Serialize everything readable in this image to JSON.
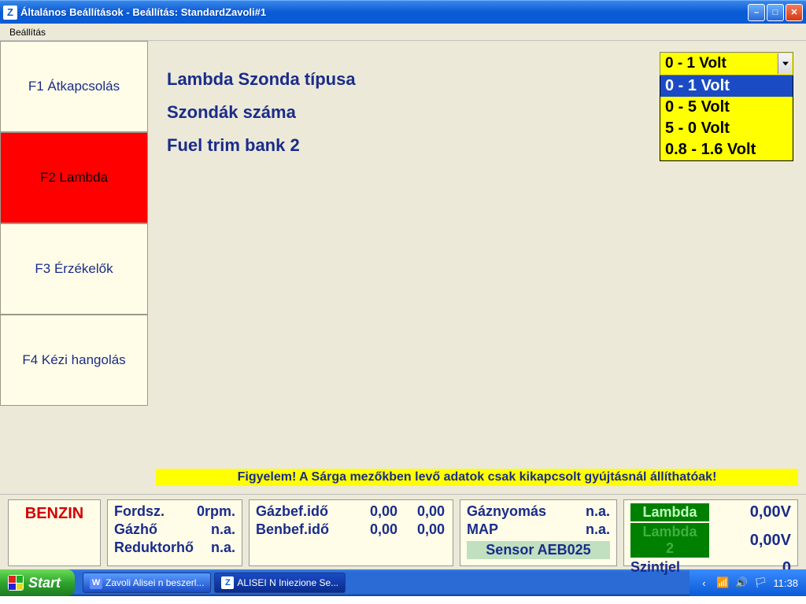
{
  "titlebar": {
    "app_icon_letter": "Z",
    "title": "Általános Beállítások - Beállítás: StandardZavoli#1"
  },
  "menubar": {
    "item": "Beállítás"
  },
  "sidebar": {
    "tabs": [
      {
        "label": "F1 Átkapcsolás"
      },
      {
        "label": "F2 Lambda"
      },
      {
        "label": "F3 Érzékelők"
      },
      {
        "label": "F4 Kézi hangolás"
      }
    ]
  },
  "main": {
    "labels": [
      "Lambda Szonda típusa",
      "Szondák száma",
      "Fuel trim bank 2"
    ],
    "combo_selected": "0 - 1 Volt",
    "combo_options": [
      "0 - 1 Volt",
      "0 - 5 Volt",
      "5 - 0 Volt",
      "0.8 - 1.6 Volt"
    ],
    "warning": "Figyelem! A Sárga mezőkben levő adatok csak kikapcsolt gyújtásnál állíthatóak!"
  },
  "status": {
    "mode": "BENZIN",
    "g1": [
      {
        "k": "Fordsz.",
        "v": "0rpm."
      },
      {
        "k": "Gázhő",
        "v": "n.a."
      },
      {
        "k": "Reduktorhő",
        "v": "n.a."
      }
    ],
    "g2": [
      {
        "k": "Gázbef.idő",
        "v1": "0,00",
        "v2": "0,00"
      },
      {
        "k": "Benbef.idő",
        "v1": "0,00",
        "v2": "0,00"
      }
    ],
    "g3": [
      {
        "k": "Gáznyomás",
        "v": "n.a."
      },
      {
        "k": "MAP",
        "v": "n.a."
      }
    ],
    "sensor": "Sensor AEB025",
    "g4": {
      "lambda1": {
        "label": "Lambda",
        "v": "0,00V"
      },
      "lambda2": {
        "label": "Lambda 2",
        "v": "0,00V"
      },
      "szint": {
        "label": "Szintjel",
        "v": "0"
      }
    }
  },
  "taskbar": {
    "start": "Start",
    "items": [
      {
        "icon": "W",
        "label": "Zavoli Alisei n beszerl..."
      },
      {
        "icon": "Z",
        "label": "ALISEI N Iniezione Se..."
      }
    ],
    "clock": "11:38"
  }
}
